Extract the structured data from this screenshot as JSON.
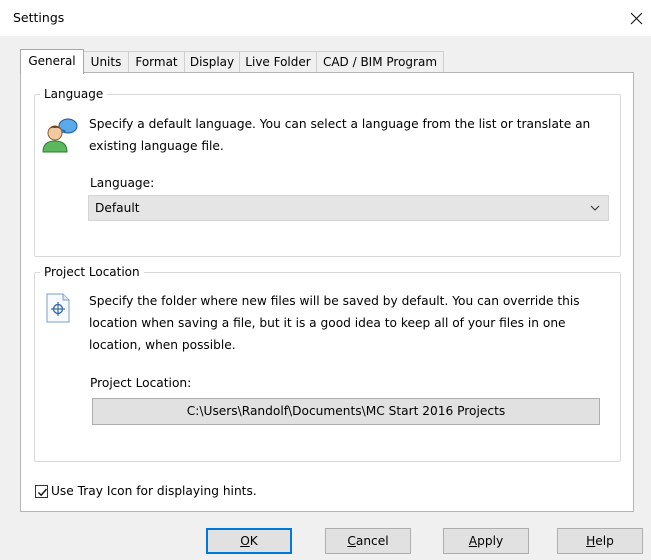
{
  "window": {
    "title": "Settings"
  },
  "tabs": [
    {
      "label": "General",
      "active": true
    },
    {
      "label": "Units",
      "active": false
    },
    {
      "label": "Format",
      "active": false
    },
    {
      "label": "Display",
      "active": false
    },
    {
      "label": "Live Folder",
      "active": false
    },
    {
      "label": "CAD / BIM Program",
      "active": false
    }
  ],
  "language": {
    "group_title": "Language",
    "description": "Specify a default language. You can select a language from the list or translate an existing language file.",
    "field_label": "Language:",
    "selected": "Default",
    "icon": "user-speech-icon"
  },
  "project_location": {
    "group_title": "Project Location",
    "description": "Specify the folder where new files will be saved by default. You can override this location when saving a file, but it is a good idea to keep all of your files in one location, when possible.",
    "field_label": "Project Location:",
    "path": "C:\\Users\\Randolf\\Documents\\MC Start 2016 Projects",
    "icon": "folder-location-icon"
  },
  "tray_icon": {
    "label": "Use Tray Icon for displaying hints.",
    "checked": true
  },
  "buttons": {
    "ok": {
      "mnemonic": "O",
      "rest": "K"
    },
    "cancel": {
      "mnemonic": "C",
      "rest": "ancel"
    },
    "apply": {
      "mnemonic": "A",
      "rest": "pply"
    },
    "help": {
      "mnemonic": "H",
      "rest": "elp"
    }
  },
  "colors": {
    "accent": "#0078d7",
    "panel": "#ffffff",
    "background": "#f0f0f0"
  }
}
